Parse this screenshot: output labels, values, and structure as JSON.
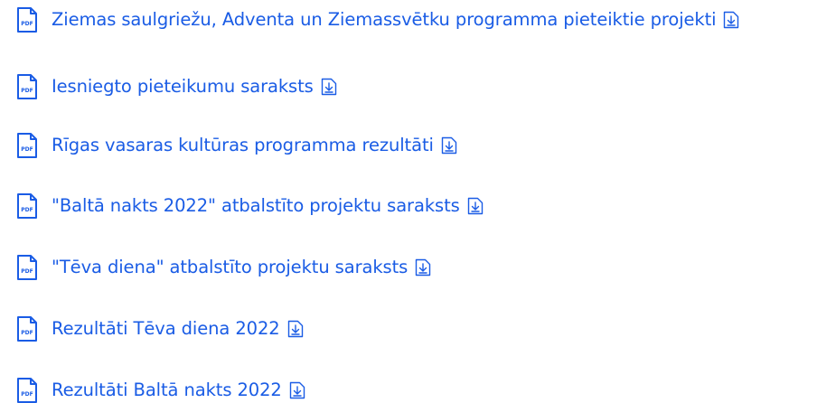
{
  "documents": [
    {
      "title": "Ziemas saulgriežu, Adventa un Ziemassvētku programma pieteiktie projekti",
      "file_type": "PDF",
      "icon": "pdf-file-icon",
      "download_icon": "download-icon"
    },
    {
      "title": "Iesniegto pieteikumu saraksts",
      "file_type": "PDF",
      "icon": "pdf-file-icon",
      "download_icon": "download-icon"
    },
    {
      "title": "Rīgas vasaras kultūras programma rezultāti",
      "file_type": "PDF",
      "icon": "pdf-file-icon",
      "download_icon": "download-icon"
    },
    {
      "title": "\"Baltā nakts 2022\" atbalstīto projektu saraksts",
      "file_type": "PDF",
      "icon": "pdf-file-icon",
      "download_icon": "download-icon"
    },
    {
      "title": "\"Tēva diena\" atbalstīto projektu saraksts",
      "file_type": "PDF",
      "icon": "pdf-file-icon",
      "download_icon": "download-icon"
    },
    {
      "title": "Rezultāti Tēva diena 2022",
      "file_type": "PDF",
      "icon": "pdf-file-icon",
      "download_icon": "download-icon"
    },
    {
      "title": "Rezultāti Baltā nakts 2022",
      "file_type": "PDF",
      "icon": "pdf-file-icon",
      "download_icon": "download-icon"
    }
  ],
  "colors": {
    "link": "#1a5ce5",
    "icon": "#1a5ce5",
    "background": "#ffffff"
  }
}
